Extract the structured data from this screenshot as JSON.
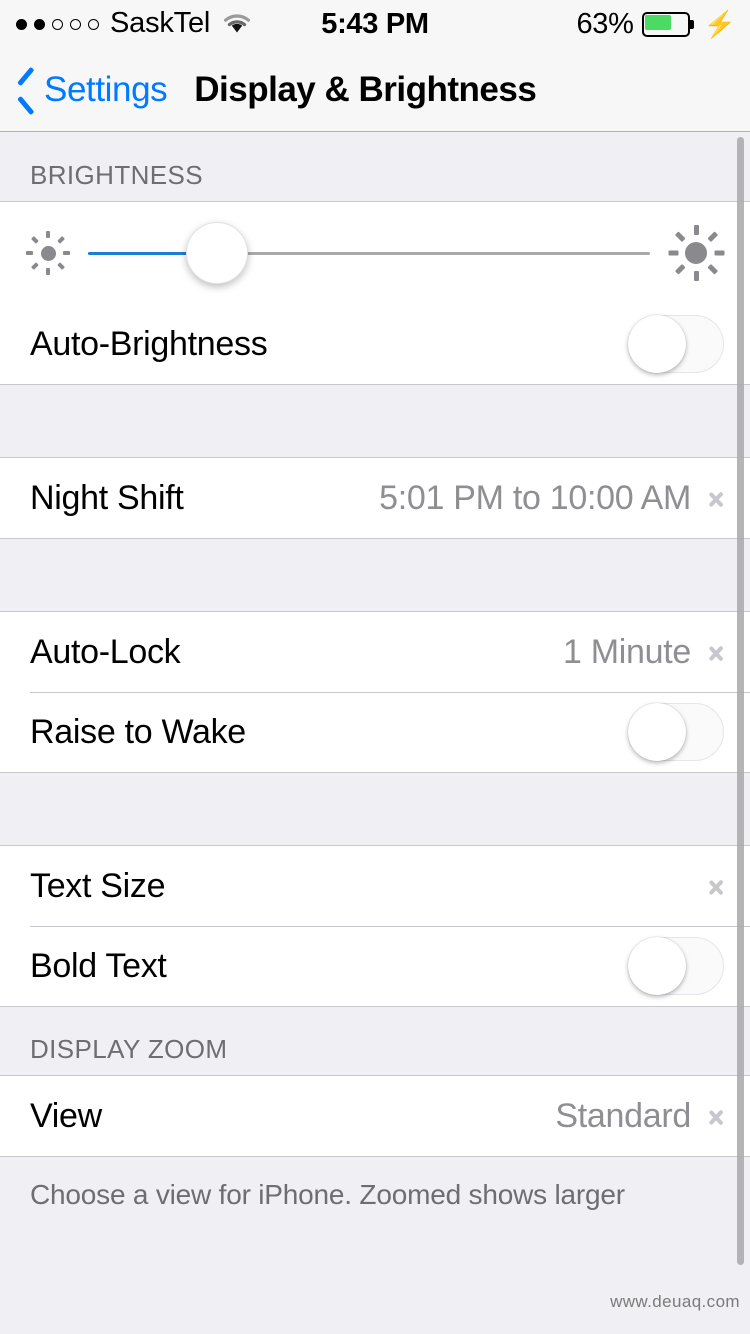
{
  "status_bar": {
    "signal_dots_filled": 2,
    "signal_dots_total": 5,
    "carrier": "SaskTel",
    "wifi_icon": "wifi-icon",
    "time": "5:43 PM",
    "battery_percent": "63%",
    "battery_level": 63,
    "battery_color": "#4cd964",
    "charging_icon": "lightning-bolt-icon"
  },
  "nav_bar": {
    "back_icon": "chevron-left-icon",
    "back_label": "Settings",
    "title": "Display & Brightness"
  },
  "brightness_section": {
    "header": "BRIGHTNESS",
    "slider": {
      "low_icon": "sun-small-icon",
      "high_icon": "sun-large-icon",
      "value_percent": 23,
      "fill_color": "#1c7ed6"
    },
    "auto_brightness": {
      "label": "Auto-Brightness",
      "toggle_state": "off"
    }
  },
  "night_shift_section": {
    "rows": [
      {
        "label": "Night Shift",
        "value": "5:01 PM to 10:00 AM",
        "accessory": "chevron-right-icon"
      }
    ]
  },
  "lock_section": {
    "rows": [
      {
        "label": "Auto-Lock",
        "value": "1 Minute",
        "accessory": "chevron-right-icon"
      },
      {
        "label": "Raise to Wake",
        "value": "",
        "accessory": "toggle-off"
      }
    ]
  },
  "text_section": {
    "rows": [
      {
        "label": "Text Size",
        "value": "",
        "accessory": "chevron-right-icon"
      },
      {
        "label": "Bold Text",
        "value": "",
        "accessory": "toggle-off"
      }
    ]
  },
  "display_zoom_section": {
    "header": "DISPLAY ZOOM",
    "rows": [
      {
        "label": "View",
        "value": "Standard",
        "accessory": "chevron-right-icon"
      }
    ],
    "footer": "Choose a view for iPhone. Zoomed shows larger"
  },
  "watermark": "www.deuaq.com",
  "colors": {
    "accent_blue": "#007aff",
    "group_background": "#ffffff",
    "page_background": "#efeff4",
    "separator": "#c8c7cc",
    "secondary_text": "#8e8e93",
    "header_text": "#6d6d72"
  }
}
